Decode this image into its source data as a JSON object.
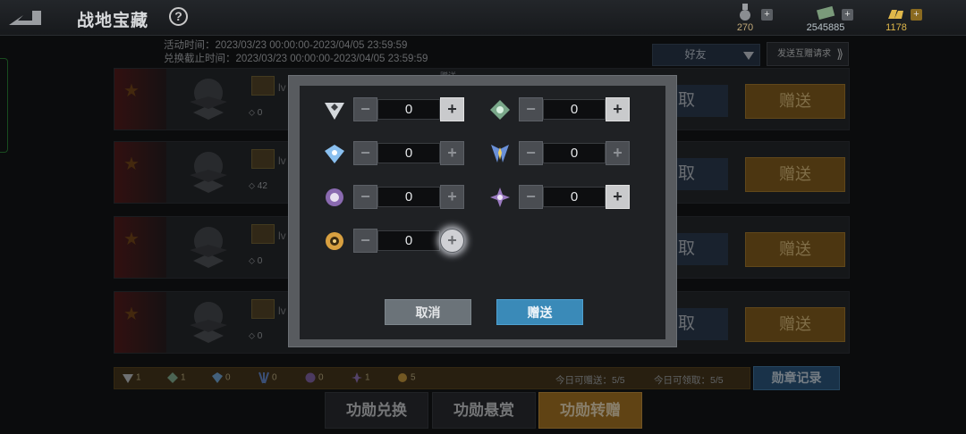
{
  "header": {
    "title": "战地宝藏",
    "help_label": "?"
  },
  "currencies": [
    {
      "icon": "medal-currency-icon",
      "value": "270",
      "color": "#c0a878"
    },
    {
      "icon": "cash-icon",
      "value": "2545885",
      "color": "#b8c2c8"
    },
    {
      "icon": "gold-bars-icon",
      "value": "1178",
      "color": "#e0b84a"
    }
  ],
  "event": {
    "activity_time": "活动时间：2023/03/23 00:00:00-2023/04/05 23:59:59",
    "exchange_deadline": "兑换截止时间：2023/03/23 00:00:00-2023/04/05 23:59:59"
  },
  "filter": {
    "friend_label": "好友",
    "send_request_label": "发送互赠请求"
  },
  "rows": [
    {
      "lv": "lv",
      "medal_count": "0",
      "claim": "取",
      "give": "赠送"
    },
    {
      "lv": "lv",
      "medal_count": "42",
      "claim": "取",
      "give": "赠送"
    },
    {
      "lv": "lv",
      "medal_count": "0",
      "claim": "取",
      "give": "赠送"
    },
    {
      "lv": "lv",
      "medal_count": "0",
      "claim": "取",
      "give": "赠送"
    }
  ],
  "dialog": {
    "hidden_text": "赠送",
    "slots": [
      {
        "icon": "silver-star-medal-icon",
        "value": "0",
        "plus_active": true
      },
      {
        "icon": "green-gem-medal-icon",
        "value": "0",
        "plus_active": true
      },
      {
        "icon": "blue-diamond-medal-icon",
        "value": "0",
        "plus_active": false
      },
      {
        "icon": "blue-wings-medal-icon",
        "value": "0",
        "plus_active": false
      },
      {
        "icon": "purple-crest-medal-icon",
        "value": "0",
        "plus_active": false
      },
      {
        "icon": "purple-star-medal-icon",
        "value": "0",
        "plus_active": true
      },
      {
        "icon": "gold-sun-medal-icon",
        "value": "0",
        "plus_active": false
      }
    ],
    "minus": "−",
    "plus": "+",
    "cancel_label": "取消",
    "send_label": "赠送"
  },
  "inventory": [
    {
      "icon": "silver-star-medal-icon",
      "count": "1"
    },
    {
      "icon": "green-gem-medal-icon",
      "count": "1"
    },
    {
      "icon": "blue-diamond-medal-icon",
      "count": "0"
    },
    {
      "icon": "blue-wings-medal-icon",
      "count": "0"
    },
    {
      "icon": "purple-crest-medal-icon",
      "count": "0"
    },
    {
      "icon": "purple-star-medal-icon",
      "count": "1"
    },
    {
      "icon": "gold-sun-medal-icon",
      "count": "5"
    }
  ],
  "quota": {
    "give": "今日可赠送：5/5",
    "receive": "今日可领取：5/5"
  },
  "record_label": "勋章记录",
  "tabs": [
    {
      "label": "功勋兑换",
      "active": false
    },
    {
      "label": "功勋悬赏",
      "active": false
    },
    {
      "label": "功勋转赠",
      "active": true
    }
  ],
  "colors": {
    "accent_gold": "#b07a25",
    "accent_blue": "#3a8ab8"
  }
}
